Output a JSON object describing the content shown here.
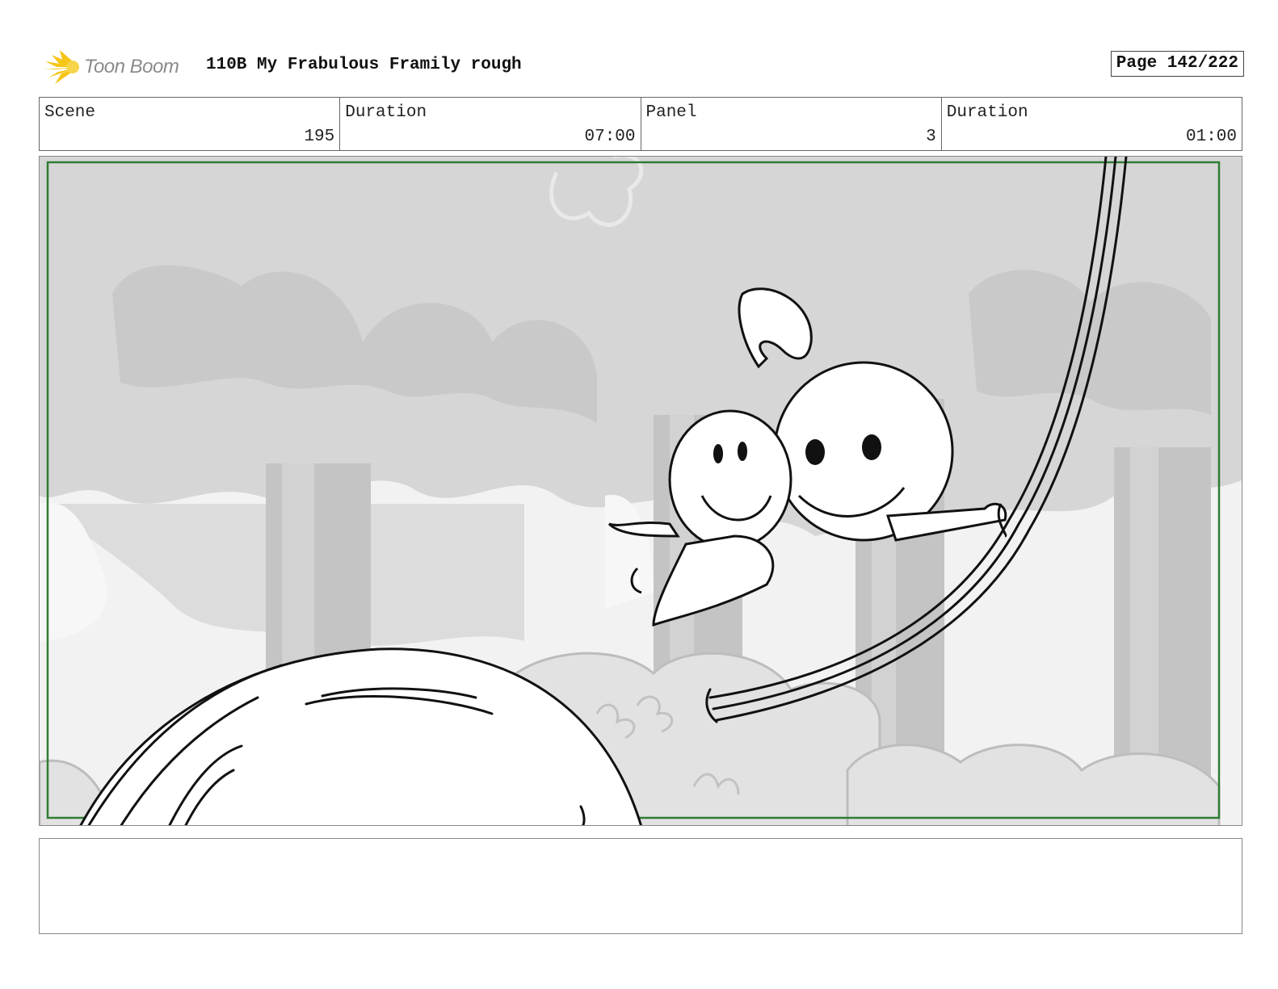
{
  "header": {
    "brand": "Toon Boom",
    "title": "110B My Frabulous Framily rough",
    "page_label": "Page 142/222"
  },
  "info": {
    "scene_label": "Scene",
    "scene_value": "195",
    "scene_duration_label": "Duration",
    "scene_duration_value": "07:00",
    "panel_label": "Panel",
    "panel_value": "3",
    "panel_duration_label": "Duration",
    "panel_duration_value": "01:00"
  },
  "panel": {
    "safe_frame_color": "#2e7d32",
    "background_tone": "#dcdcdc"
  },
  "notes": {
    "text": ""
  },
  "colors": {
    "logo_yellow": "#f5c518",
    "border": "#666666"
  }
}
